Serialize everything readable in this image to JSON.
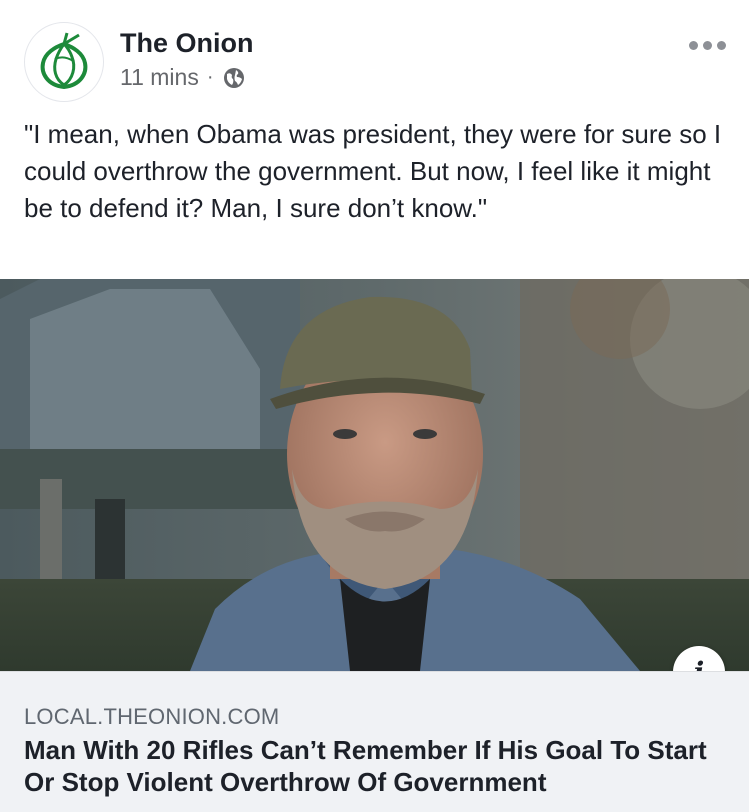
{
  "post": {
    "page_name": "The Onion",
    "time": "11 mins",
    "separator": "·",
    "audience_icon": "globe-icon",
    "more_icon": "more-options-icon",
    "text": "\"I mean, when Obama was president, they were for sure so I could overthrow the government. But now, I feel like it might be to defend it? Man, I sure don’t know.\""
  },
  "link": {
    "info_label": "i",
    "domain": "LOCAL.THEONION.COM",
    "title": "Man With 20 Rifles Can’t Remember If His Goal To Start Or Stop Violent Overthrow Of Government"
  },
  "colors": {
    "brand_green": "#1d8a3a",
    "card_background": "#f0f2f5",
    "meta_text": "#65676b"
  }
}
